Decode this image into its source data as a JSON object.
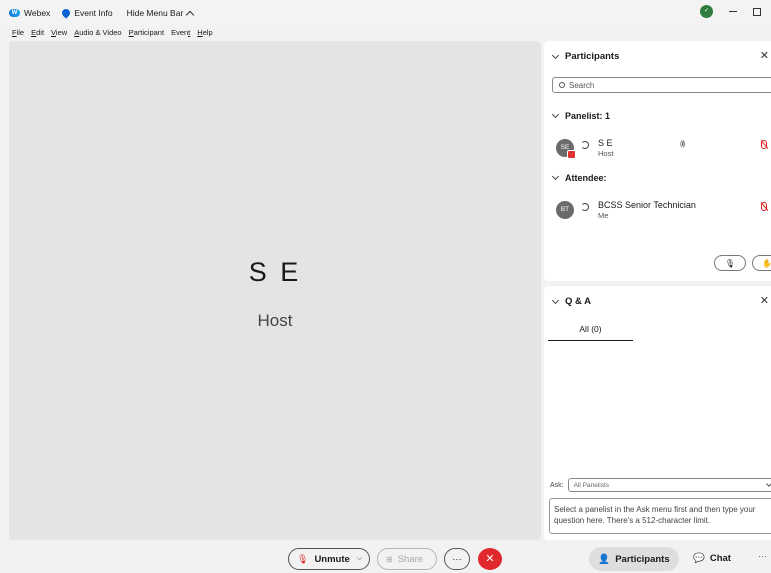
{
  "titlebar": {
    "app_name": "Webex",
    "event_info": "Event Info",
    "hide_menu_bar": "Hide Menu Bar"
  },
  "menubar": {
    "items": [
      {
        "accel": "F",
        "rest": "ile"
      },
      {
        "accel": "E",
        "rest": "dit"
      },
      {
        "accel": "V",
        "rest": "iew"
      },
      {
        "accel": "A",
        "rest": "udio & Video"
      },
      {
        "accel": "P",
        "rest": "articipant"
      },
      {
        "pre": "Even",
        "accel": "t",
        "rest": ""
      },
      {
        "accel": "H",
        "rest": "elp"
      }
    ]
  },
  "stage": {
    "name": "S E",
    "role": "Host"
  },
  "participants_panel": {
    "title": "Participants",
    "search_placeholder": "Search",
    "panelist_section": "Panelist: 1",
    "attendee_section": "Attendee:",
    "panelists": [
      {
        "initials": "SE",
        "name": "S E",
        "role": "Host"
      }
    ],
    "attendees": [
      {
        "initials": "BT",
        "name": "BCSS Senior Technician",
        "role": "Me"
      }
    ]
  },
  "qa_panel": {
    "title": "Q & A",
    "tab": "All (0)",
    "ask_label": "Ask:",
    "ask_value": "All Panelists",
    "question_placeholder": "Select a panelist in the Ask menu first and then type your question here. There's a 512-character limit."
  },
  "toolbar": {
    "unmute": "Unmute",
    "share": "Share",
    "more": "···",
    "end": "✕",
    "participants": "Participants",
    "chat": "Chat",
    "overflow": "···"
  },
  "colors": {
    "end_button": "#e0282e",
    "mic_muted": "#d22222",
    "brand": "#0c7bd5"
  }
}
